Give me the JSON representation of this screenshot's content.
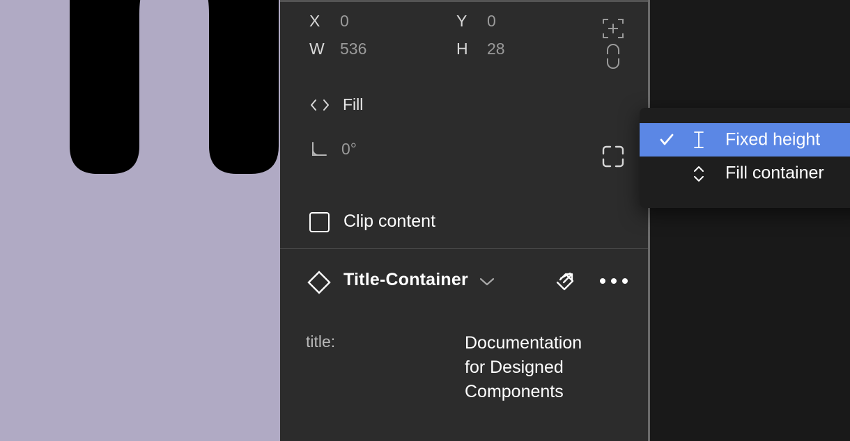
{
  "canvas": {
    "glyph": "n",
    "glyph_color": "#000000",
    "background_color": "#b0aac4"
  },
  "panel": {
    "background_color": "#2c2c2c",
    "accent_color": "#5b87e5",
    "position_section": {
      "x": {
        "label": "X",
        "value": "0"
      },
      "y": {
        "label": "Y",
        "value": "0"
      },
      "w": {
        "label": "W",
        "value": "536"
      },
      "h": {
        "label": "H",
        "value": "28"
      },
      "constrain_icon": "constrain-proportions-crosshair-icon",
      "lock_aspect_icon": "lock-aspect-ratio-open-icon"
    },
    "resizing_section": {
      "horizontal_resizing": {
        "icon": "horizontal-resizing-icon",
        "value": "Fill"
      },
      "rotation": {
        "icon": "rotation-angle-icon",
        "value": "0°"
      },
      "corner_radius_icon": "independent-corners-icon"
    },
    "clip_content": {
      "label": "Clip content",
      "checked": false
    },
    "component_section": {
      "component_icon": "component-diamond-icon",
      "name": "Title-Container",
      "chevron_icon": "chevron-down-icon",
      "swap_icon": "go-to-main-component-icon",
      "more_icon": "more-options-icon",
      "properties": [
        {
          "label": "title:",
          "value": "Documentation for Designed Components"
        }
      ]
    }
  },
  "dropdown": {
    "visible": true,
    "items": [
      {
        "label": "Fixed height",
        "icon": "text-cursor-icon",
        "selected": true,
        "check_icon": "checkmark-icon"
      },
      {
        "label": "Fill container",
        "icon": "vertical-arrows-icon",
        "selected": false,
        "check_icon": ""
      }
    ]
  }
}
